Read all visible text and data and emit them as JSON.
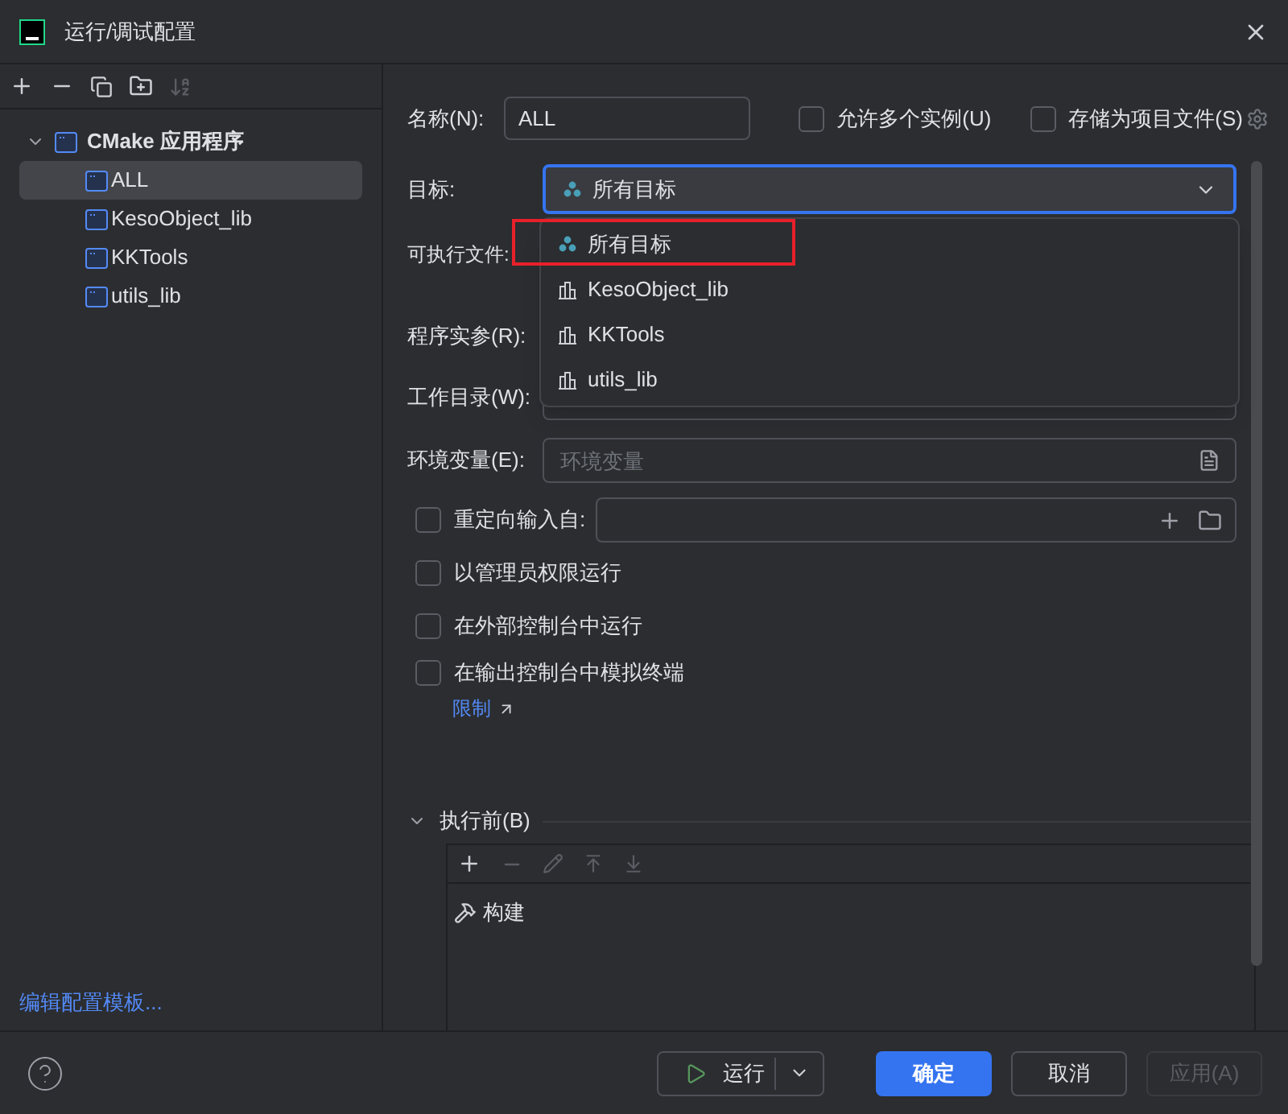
{
  "window": {
    "title": "运行/调试配置"
  },
  "tree": {
    "label": "CMake 应用程序",
    "expanded": true,
    "children": [
      {
        "label": "ALL",
        "selected": true
      },
      {
        "label": "KesoObject_lib",
        "selected": false
      },
      {
        "label": "KKTools",
        "selected": false
      },
      {
        "label": "utils_lib",
        "selected": false
      }
    ]
  },
  "template_link": "编辑配置模板...",
  "form": {
    "name": {
      "label": "名称(N):",
      "value": "ALL"
    },
    "top_checks": [
      {
        "label": "允许多个实例(U)",
        "checked": false
      },
      {
        "label": "存储为项目文件(S)",
        "checked": false
      }
    ],
    "target": {
      "label": "目标:",
      "value": "所有目标"
    },
    "dropdown": [
      {
        "label": "所有目标",
        "kind": "all",
        "highlighted": true
      },
      {
        "label": "KesoObject_lib",
        "kind": "lib",
        "highlighted": false
      },
      {
        "label": "KKTools",
        "kind": "lib",
        "highlighted": false
      },
      {
        "label": "utils_lib",
        "kind": "lib",
        "highlighted": false
      }
    ],
    "executable_label": "可执行文件:",
    "args_label": "程序实参(R):",
    "workdir_label": "工作目录(W):",
    "env": {
      "label": "环境变量(E):",
      "placeholder": "环境变量"
    },
    "redirect": {
      "label": "重定向输入自:",
      "checked": false
    },
    "options": [
      {
        "label": "以管理员权限运行",
        "checked": false
      },
      {
        "label": "在外部控制台中运行",
        "checked": false
      },
      {
        "label": "在输出控制台中模拟终端",
        "checked": false
      }
    ],
    "limit_link": "限制",
    "before_launch": {
      "title": "执行前(B)",
      "expanded": true,
      "tasks": [
        {
          "label": "构建"
        }
      ]
    }
  },
  "buttons": {
    "run": "运行",
    "ok": "确定",
    "cancel": "取消",
    "apply": {
      "label": "应用(A)",
      "disabled": true
    }
  }
}
